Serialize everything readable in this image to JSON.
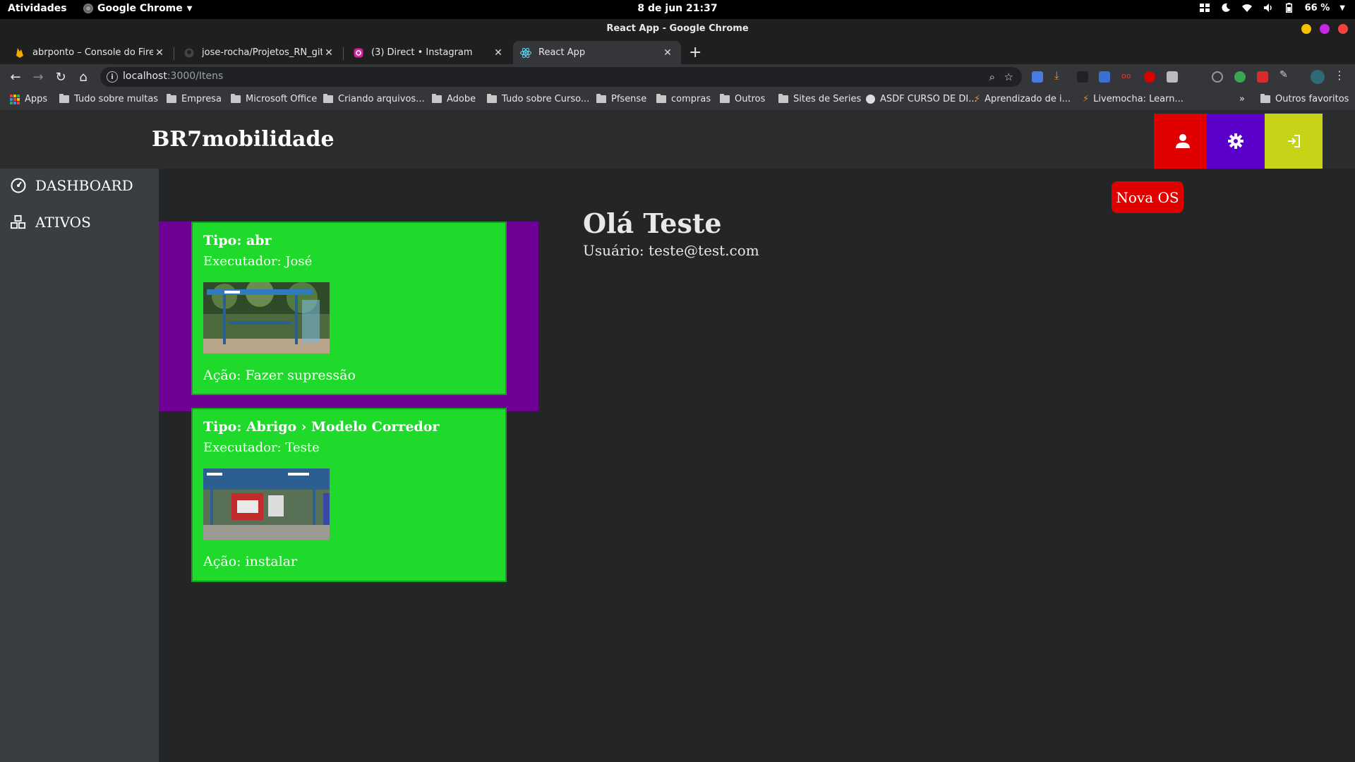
{
  "system_bar": {
    "activities": "Atividades",
    "app_menu": "Google Chrome",
    "clock": "8 de jun  21:37",
    "battery": "66 %"
  },
  "window": {
    "title": "React App - Google Chrome"
  },
  "tabs": [
    {
      "label": "abrponto – Console do Fireba",
      "icon": "firebase-icon"
    },
    {
      "label": "jose-rocha/Projetos_RN_git:",
      "icon": "github-icon"
    },
    {
      "label": "(3) Direct • Instagram",
      "icon": "instagram-icon"
    },
    {
      "label": "React App",
      "icon": "react-icon",
      "active": true
    }
  ],
  "address_bar": {
    "host": "localhost",
    "path": ":3000/Itens"
  },
  "bookmarks": {
    "apps": "Apps",
    "items": [
      "Tudo sobre multas",
      "Empresa",
      "Microsoft Office",
      "Criando arquivos...",
      "Adobe",
      "Tudo sobre Curso...",
      "Pfsense",
      "compras",
      "Outros",
      "Sites de Series",
      "ASDF CURSO DE DI...",
      "Aprendizado de i...",
      "Livemocha: Learn..."
    ],
    "overflow": "»",
    "other": "Outros favoritos"
  },
  "app": {
    "brand": "BR7mobilidade",
    "header_buttons": [
      {
        "name": "profile",
        "color": "#e00000",
        "icon": "user-icon"
      },
      {
        "name": "settings",
        "color": "#5b00c8",
        "icon": "gear-icon"
      },
      {
        "name": "logout",
        "color": "#c6d316",
        "icon": "sign-in-icon"
      }
    ],
    "sidebar": [
      {
        "label": "DASHBOARD",
        "icon": "dashboard-gauge-icon"
      },
      {
        "label": "ATIVOS",
        "icon": "cubes-icon"
      }
    ],
    "new_os_label": "Nova OS",
    "greeting": "Olá Teste",
    "user_line": "Usuário: teste@test.com",
    "cards": [
      {
        "title": "Tipo: abr",
        "executor": "Executador: José",
        "action": "Ação: Fazer supressão",
        "image": "bus-shelter-photo"
      },
      {
        "title": "Tipo: Abrigo › Modelo Corredor",
        "executor": "Executador: Teste",
        "action": "Ação: instalar",
        "image": "bus-shelter-photo"
      }
    ]
  }
}
